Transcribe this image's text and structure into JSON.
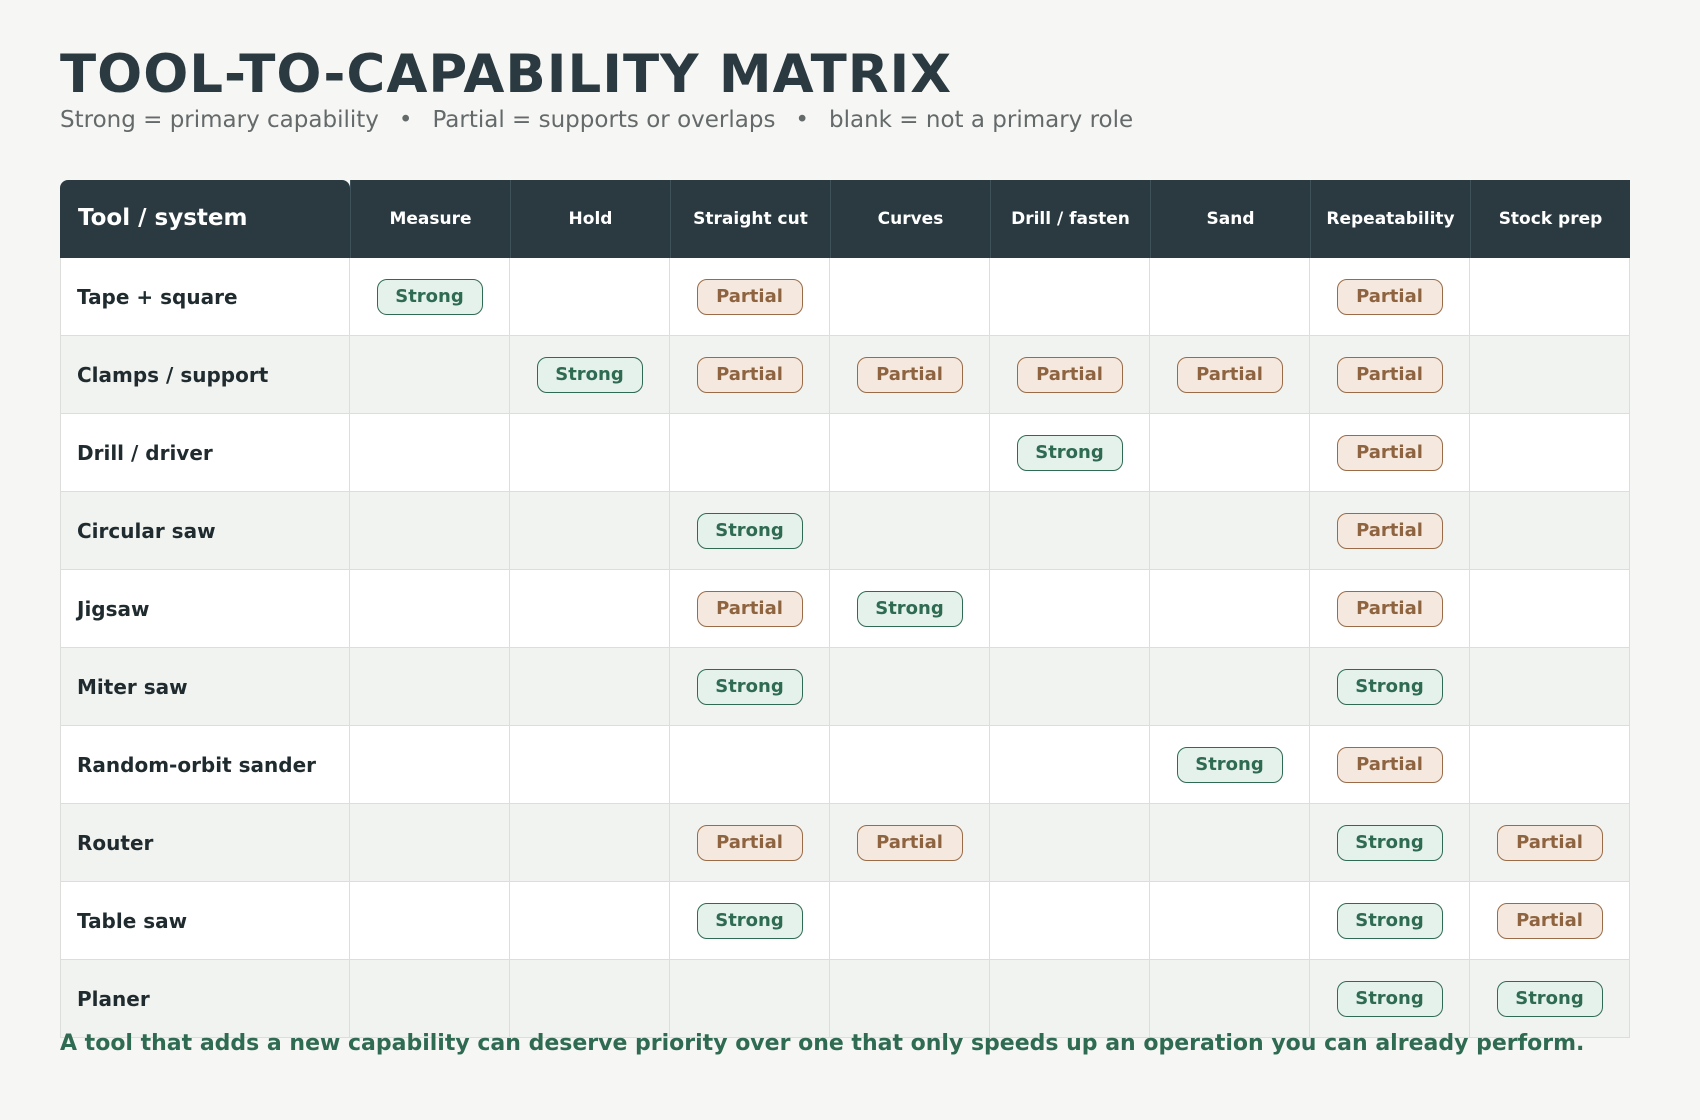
{
  "title": "TOOL-TO-CAPABILITY MATRIX",
  "legend": {
    "strong_text": "Strong = primary capability",
    "partial_text": "Partial = supports or overlaps",
    "blank_text": "blank = not a primary role",
    "separator": "•"
  },
  "columns": [
    "Tool / system",
    "Measure",
    "Hold",
    "Straight cut",
    "Curves",
    "Drill / fasten",
    "Sand",
    "Repeatability",
    "Stock prep"
  ],
  "rows": [
    {
      "tool": "Tape + square",
      "cells": [
        "Strong",
        "",
        "Partial",
        "",
        "",
        "",
        "Partial",
        ""
      ]
    },
    {
      "tool": "Clamps / support",
      "cells": [
        "",
        "Strong",
        "Partial",
        "Partial",
        "Partial",
        "Partial",
        "Partial",
        ""
      ]
    },
    {
      "tool": "Drill / driver",
      "cells": [
        "",
        "",
        "",
        "",
        "Strong",
        "",
        "Partial",
        ""
      ]
    },
    {
      "tool": "Circular saw",
      "cells": [
        "",
        "",
        "Strong",
        "",
        "",
        "",
        "Partial",
        ""
      ]
    },
    {
      "tool": "Jigsaw",
      "cells": [
        "",
        "",
        "Partial",
        "Strong",
        "",
        "",
        "Partial",
        ""
      ]
    },
    {
      "tool": "Miter saw",
      "cells": [
        "",
        "",
        "Strong",
        "",
        "",
        "",
        "Strong",
        ""
      ]
    },
    {
      "tool": "Random-orbit sander",
      "cells": [
        "",
        "",
        "",
        "",
        "",
        "Strong",
        "Partial",
        ""
      ]
    },
    {
      "tool": "Router",
      "cells": [
        "",
        "",
        "Partial",
        "Partial",
        "",
        "",
        "Strong",
        "Partial"
      ]
    },
    {
      "tool": "Table saw",
      "cells": [
        "",
        "",
        "Strong",
        "",
        "",
        "",
        "Strong",
        "Partial"
      ]
    },
    {
      "tool": "Planer",
      "cells": [
        "",
        "",
        "",
        "",
        "",
        "",
        "Strong",
        "Strong"
      ]
    }
  ],
  "footnote": "A tool that adds a new capability can deserve priority over one that only speeds up an operation you can already perform.",
  "colors": {
    "header_bg": "#2a3a40",
    "strong": "#2f6b52",
    "strong_bg": "#e5f2ec",
    "partial": "#9b6b47",
    "partial_bg": "#f4e8df"
  }
}
